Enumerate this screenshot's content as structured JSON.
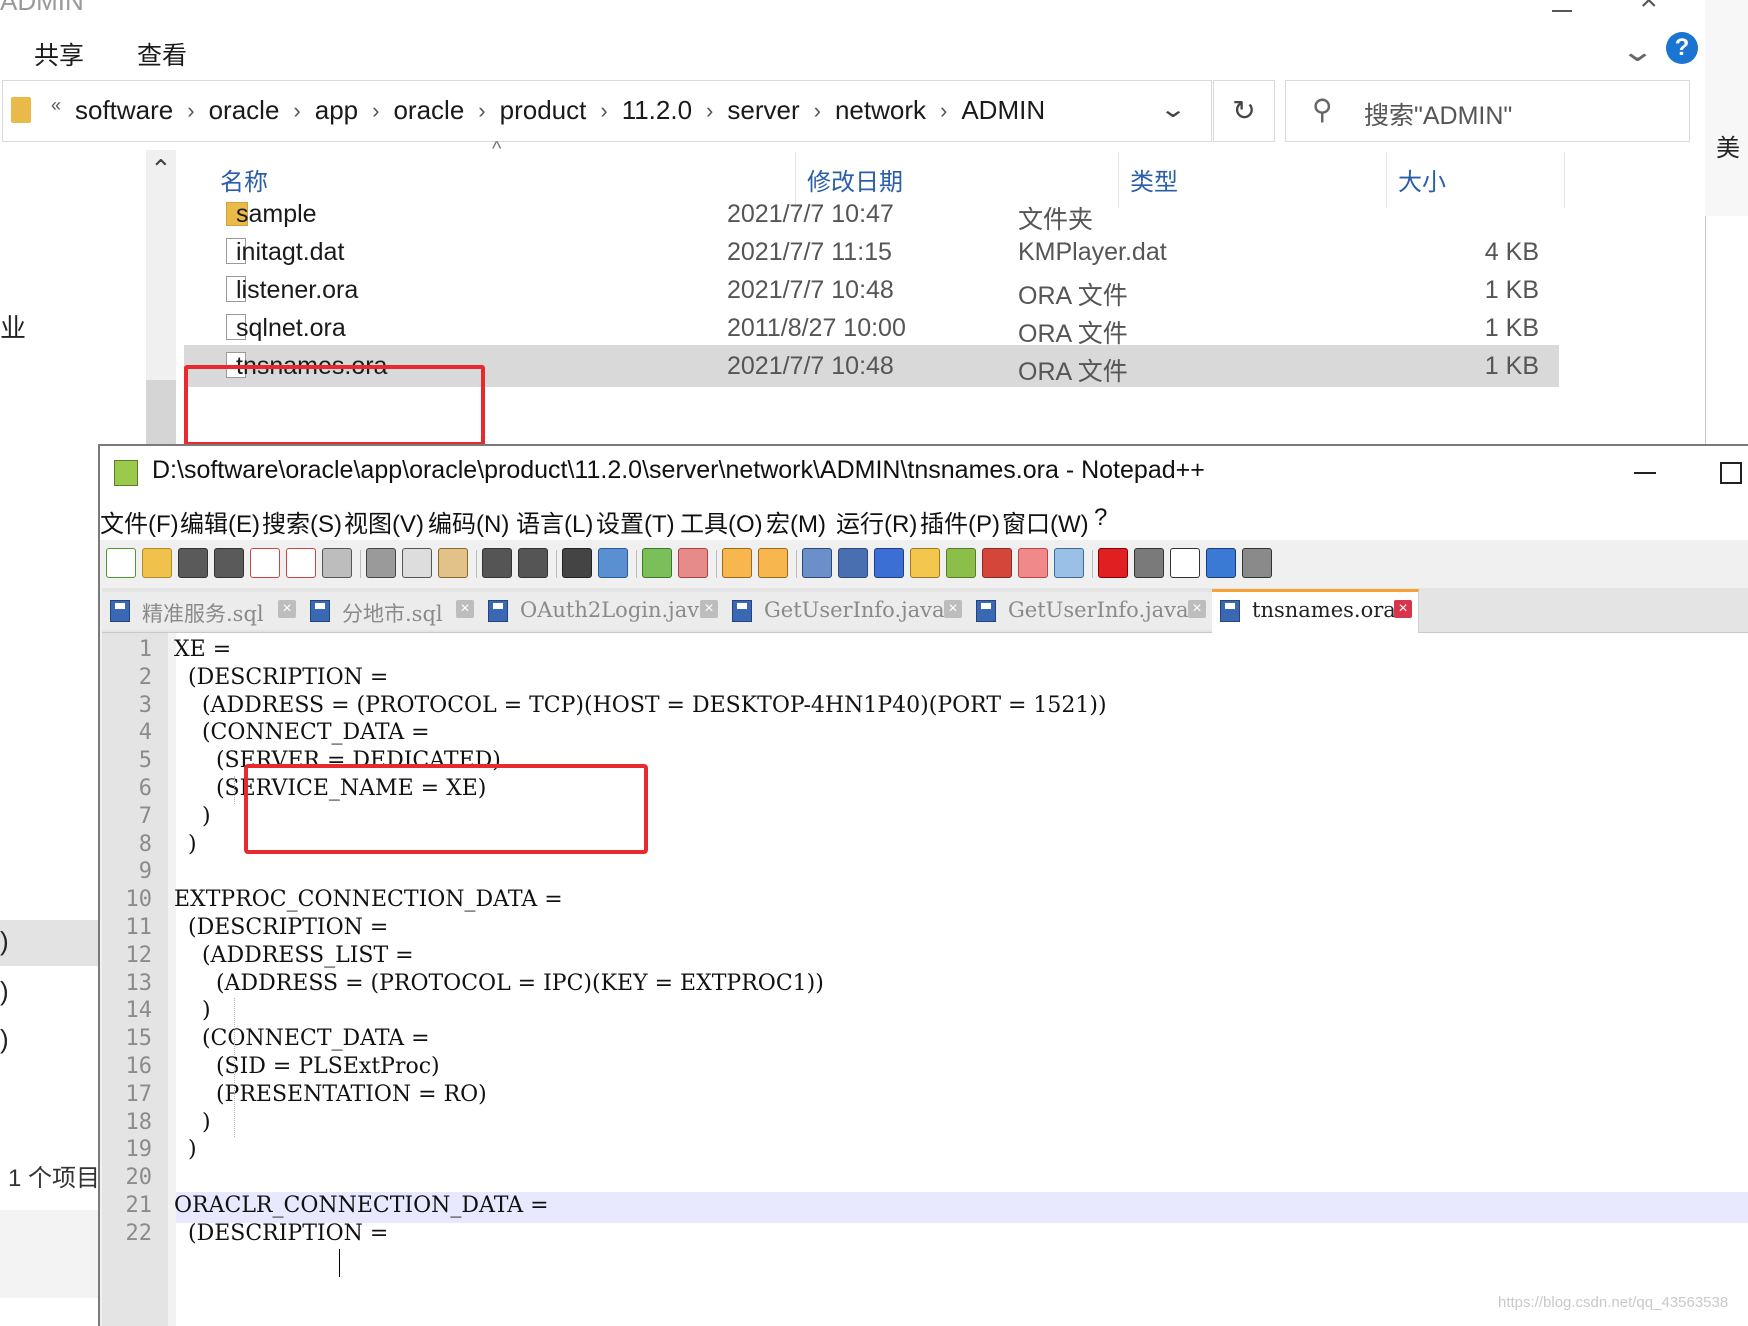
{
  "explorer": {
    "title": "ADMIN",
    "ribbon_tabs": [
      "共享",
      "查看"
    ],
    "breadcrumb": [
      "software",
      "oracle",
      "app",
      "oracle",
      "product",
      "11.2.0",
      "server",
      "network",
      "ADMIN"
    ],
    "search_placeholder": "搜索\"ADMIN\"",
    "columns": [
      "名称",
      "修改日期",
      "类型",
      "大小"
    ],
    "files": [
      {
        "name": "sample",
        "date": "2021/7/7 10:47",
        "type": "文件夹",
        "size": "",
        "icon": "folder-icon"
      },
      {
        "name": "initagt.dat",
        "date": "2021/7/7 11:15",
        "type": "KMPlayer.dat",
        "size": "4 KB",
        "icon": "file-icon"
      },
      {
        "name": "listener.ora",
        "date": "2021/7/7 10:48",
        "type": "ORA 文件",
        "size": "1 KB",
        "icon": "file-icon"
      },
      {
        "name": "sqlnet.ora",
        "date": "2011/8/27 10:00",
        "type": "ORA 文件",
        "size": "1 KB",
        "icon": "file-icon"
      },
      {
        "name": "tnsnames.ora",
        "date": "2021/7/7 10:48",
        "type": "ORA 文件",
        "size": "1 KB",
        "icon": "file-icon",
        "selected": true
      }
    ],
    "status": "1 个项目",
    "nav_fragments": [
      "业",
      ")",
      ")",
      ")"
    ],
    "right_fragment": "美"
  },
  "notepad": {
    "title": "D:\\software\\oracle\\app\\oracle\\product\\11.2.0\\server\\network\\ADMIN\\tnsnames.ora - Notepad++",
    "menu": [
      "文件(F)",
      "编辑(E)",
      "搜索(S)",
      "视图(V)",
      "编码(N)",
      "语言(L)",
      "设置(T)",
      "工具(O)",
      "宏(M)",
      "运行(R)",
      "插件(P)",
      "窗口(W)",
      "?"
    ],
    "tabs": [
      {
        "label": "精准服务.sql",
        "active": false
      },
      {
        "label": "分地市.sql",
        "active": false
      },
      {
        "label": "OAuth2Login.java",
        "active": false
      },
      {
        "label": "GetUserInfo.java",
        "active": false
      },
      {
        "label": "GetUserInfo.java",
        "active": false
      },
      {
        "label": "tnsnames.ora",
        "active": true
      }
    ],
    "current_line": 21,
    "lines": [
      "XE =",
      "  (DESCRIPTION =",
      "    (ADDRESS = (PROTOCOL = TCP)(HOST = DESKTOP-4HN1P40)(PORT = 1521))",
      "    (CONNECT_DATA =",
      "      (SERVER = DEDICATED)",
      "      (SERVICE_NAME = XE)",
      "    )",
      "  )",
      "",
      "EXTPROC_CONNECTION_DATA =",
      "  (DESCRIPTION =",
      "    (ADDRESS_LIST =",
      "      (ADDRESS = (PROTOCOL = IPC)(KEY = EXTPROC1))",
      "    )",
      "    (CONNECT_DATA =",
      "      (SID = PLSExtProc)",
      "      (PRESENTATION = RO)",
      "    )",
      "  )",
      "",
      "ORACLR_CONNECTION_DATA =",
      "  (DESCRIPTION ="
    ]
  },
  "watermark": "https://blog.csdn.net/qq_43563538"
}
